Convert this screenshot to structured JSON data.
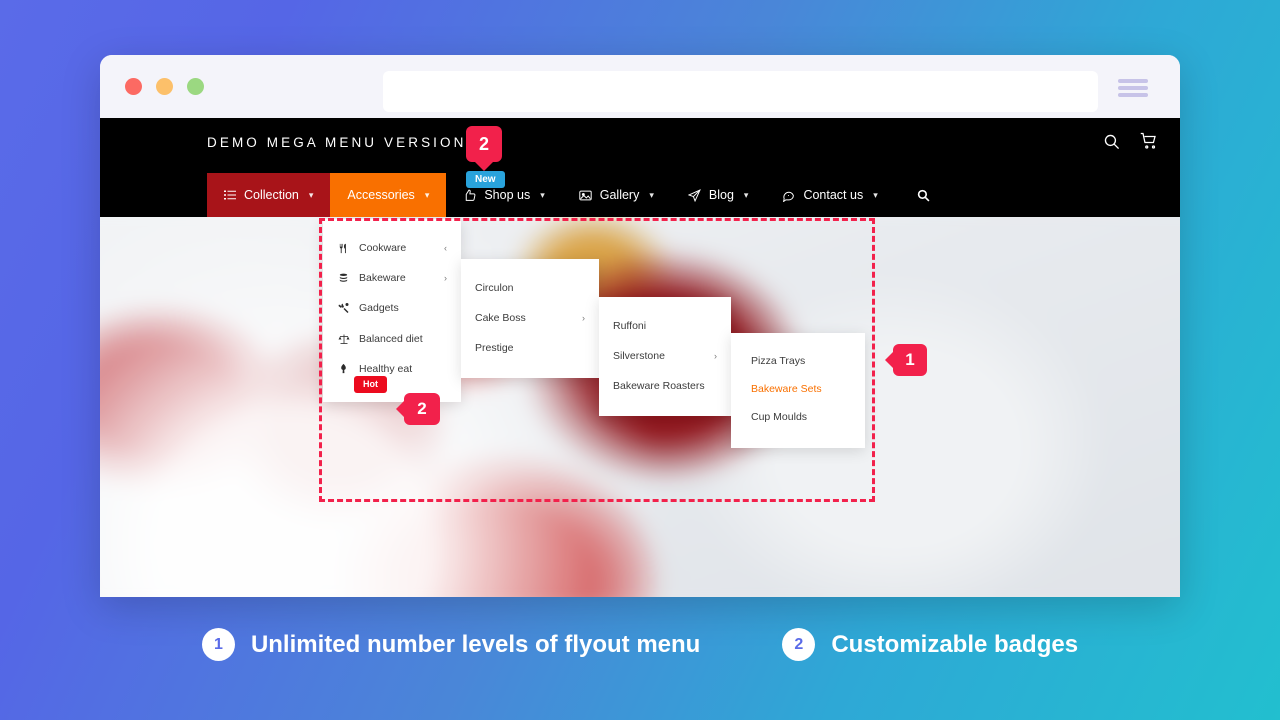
{
  "browser": {
    "traffic_lights": [
      "close",
      "minimize",
      "maximize"
    ],
    "url_value": "",
    "url_placeholder": "",
    "menu_icon": "hamburger-icon"
  },
  "site": {
    "logo": "DEMO MEGA MENU VERSION 2",
    "header_icons": [
      "search-icon",
      "cart-icon"
    ]
  },
  "navbar": {
    "items": [
      {
        "label": "Collection",
        "icon": "list-icon",
        "caret": "⌄",
        "state": "active-red"
      },
      {
        "label": "Accessories",
        "icon": "",
        "caret": "⌄",
        "state": "active-orange"
      },
      {
        "label": "Shop us",
        "icon": "thumbsup-icon",
        "caret": "⌄",
        "state": "default",
        "badge": "New"
      },
      {
        "label": "Gallery",
        "icon": "image-icon",
        "caret": "⌄",
        "state": "default"
      },
      {
        "label": "Blog",
        "icon": "paperplane-icon",
        "caret": "⌄",
        "state": "default"
      },
      {
        "label": "Contact us",
        "icon": "chat-icon",
        "caret": "⌄",
        "state": "default"
      }
    ],
    "search_icon": "search-icon"
  },
  "menu": {
    "level1": [
      {
        "label": "Cookware",
        "icon": "cutlery-icon",
        "arrow": "‹"
      },
      {
        "label": "Bakeware",
        "icon": "stack-icon",
        "arrow": "›"
      },
      {
        "label": "Gadgets",
        "icon": "tools-icon",
        "arrow": ""
      },
      {
        "label": "Balanced diet",
        "icon": "scale-icon",
        "arrow": ""
      },
      {
        "label": "Healthy eat",
        "icon": "leaf-icon",
        "arrow": "",
        "badge": "Hot"
      }
    ],
    "level2": [
      {
        "label": "Circulon",
        "arrow": ""
      },
      {
        "label": "Cake Boss",
        "arrow": "›"
      },
      {
        "label": "Prestige",
        "arrow": ""
      }
    ],
    "level3": [
      {
        "label": "Ruffoni",
        "arrow": ""
      },
      {
        "label": "Silverstone",
        "arrow": "›"
      },
      {
        "label": "Bakeware Roasters",
        "arrow": ""
      }
    ],
    "level4": [
      {
        "label": "Pizza Trays",
        "thumb": "pizza",
        "active": false
      },
      {
        "label": "Bakeware Sets",
        "thumb": "bakeware",
        "active": true
      },
      {
        "label": "Cup Moulds",
        "thumb": "cup",
        "active": false
      }
    ]
  },
  "callouts": {
    "badge_top": "2",
    "badge_hot": "2",
    "flyout_right": "1"
  },
  "captions": [
    {
      "num": "1",
      "text": "Unlimited number levels of flyout menu"
    },
    {
      "num": "2",
      "text": "Customizable badges"
    }
  ],
  "colors": {
    "accent_red": "#f2214b",
    "nav_red": "#a81419",
    "nav_orange": "#f97000",
    "badge_blue": "#29a3dc",
    "hot_red": "#ec0b1e",
    "gradient_start": "#5a6be8",
    "gradient_end": "#22bfcf"
  }
}
